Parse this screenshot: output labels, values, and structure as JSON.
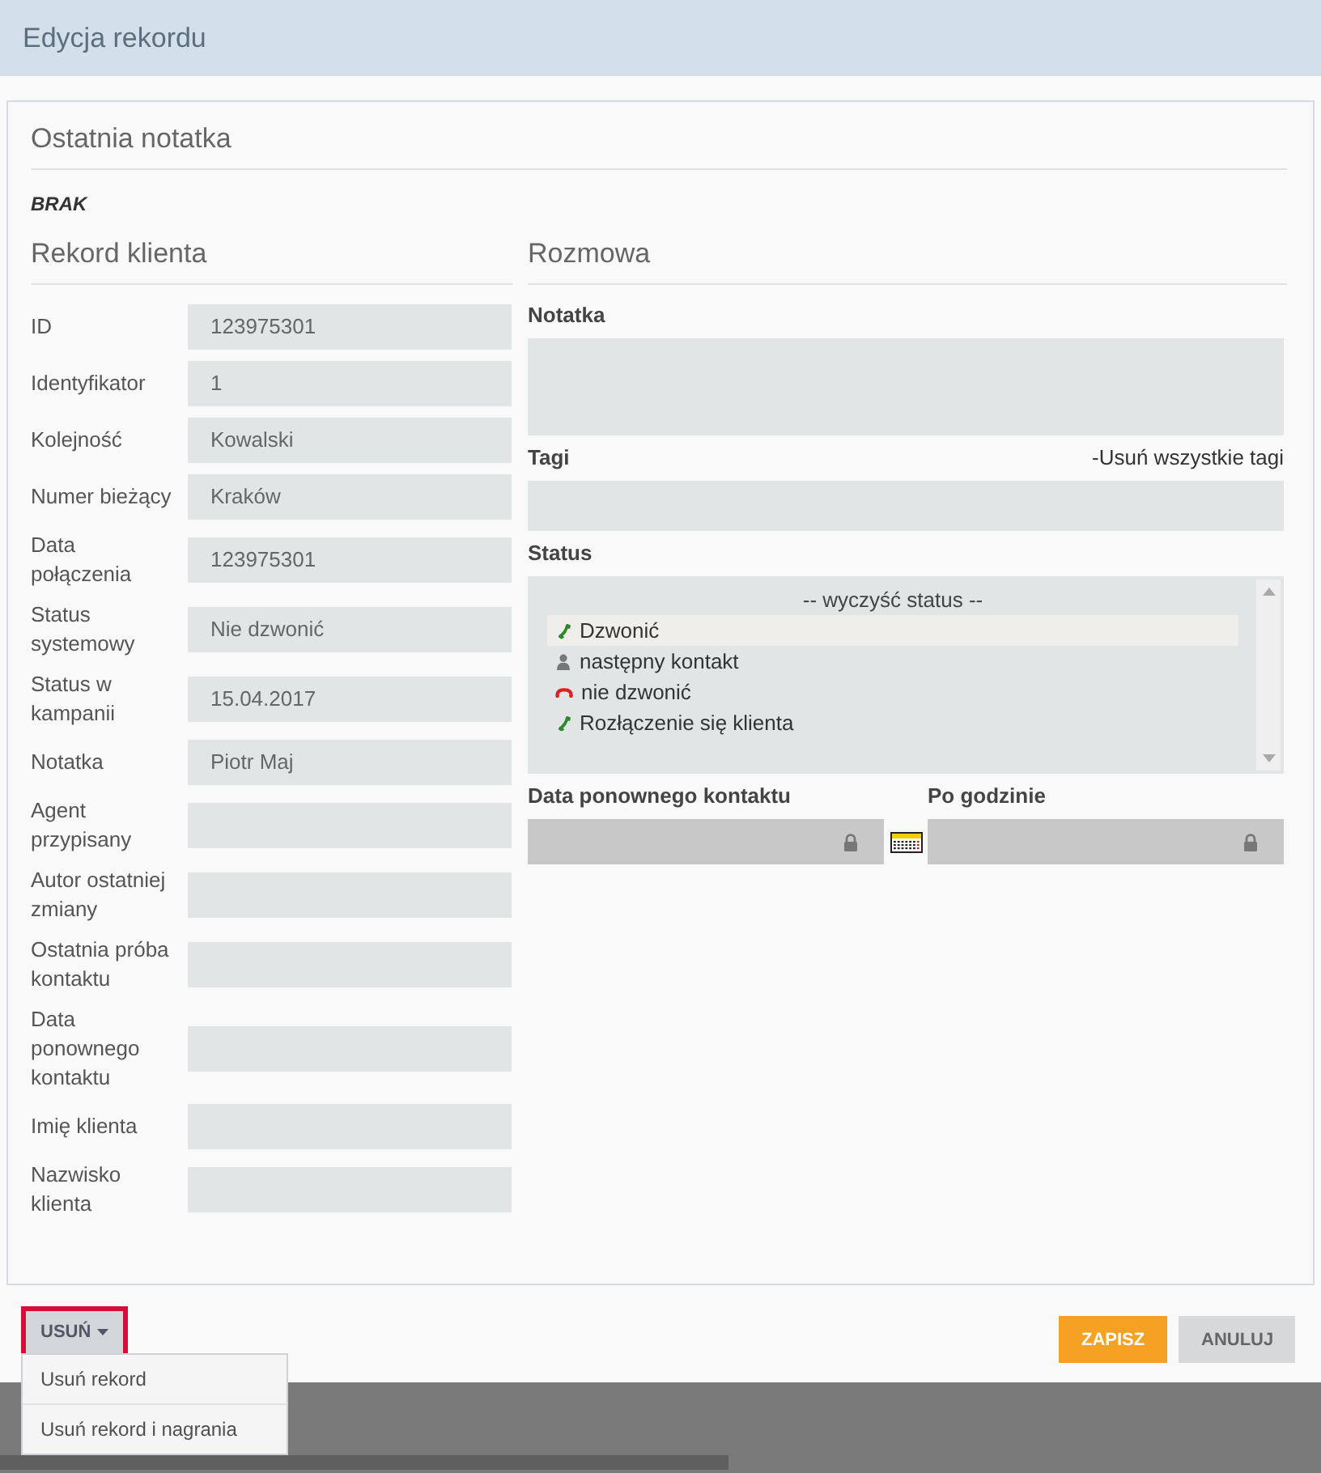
{
  "header": {
    "title": "Edycja rekordu"
  },
  "last_note": {
    "title": "Ostatnia notatka",
    "text": "BRAK"
  },
  "client_record": {
    "title": "Rekord klienta",
    "fields": [
      {
        "label": "ID",
        "value": "123975301"
      },
      {
        "label": "Identyfikator",
        "value": "1"
      },
      {
        "label": "Kolejność",
        "value": "Kowalski"
      },
      {
        "label": "Numer bieżący",
        "value": "Kraków"
      },
      {
        "label": "Data połączenia",
        "value": "123975301"
      },
      {
        "label": "Status systemowy",
        "value": "Nie dzwonić"
      },
      {
        "label": "Status w kampanii",
        "value": "15.04.2017"
      },
      {
        "label": "Notatka",
        "value": "Piotr Maj"
      },
      {
        "label": "Agent przypisany"
      },
      {
        "label": "Autor ostatniej zmiany"
      },
      {
        "label": "Ostatnia próba kontaktu"
      },
      {
        "label": "Data ponownego kontaktu"
      },
      {
        "label": "Imię klienta"
      },
      {
        "label": "Nazwisko klienta"
      }
    ]
  },
  "conversation": {
    "title": "Rozmowa",
    "note": {
      "label": "Notatka"
    },
    "tags": {
      "label": "Tagi",
      "clear_link": "-Usuń wszystkie tagi"
    },
    "status": {
      "label": "Status",
      "clear_option": "-- wyczyść status --",
      "options": [
        {
          "label": "Dzwonić",
          "kind": "call",
          "selected": true
        },
        {
          "label": "następny kontakt",
          "kind": "contact",
          "selected": false
        },
        {
          "label": "nie dzwonić",
          "kind": "reject",
          "selected": false
        },
        {
          "label": "Rozłączenie się klienta",
          "kind": "call",
          "selected": false
        }
      ]
    },
    "callback_date": {
      "label": "Data ponownego kontaktu",
      "disabled": true
    },
    "after_hour": {
      "label": "Po godzinie",
      "disabled": true
    }
  },
  "actions": {
    "delete": {
      "label": "USUŃ",
      "expanded": true,
      "focused": true,
      "menu": [
        {
          "label": "Usuń rekord"
        },
        {
          "label": "Usuń rekord i nagrania"
        }
      ]
    },
    "save": {
      "label": "ZAPISZ"
    },
    "cancel": {
      "label": "ANULUJ"
    }
  }
}
